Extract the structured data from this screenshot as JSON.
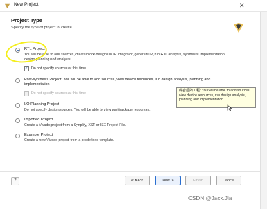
{
  "window": {
    "title": "New Project",
    "close_glyph": "✕"
  },
  "header": {
    "title": "Project Type",
    "subtitle": "Specify the type of project to create."
  },
  "options": [
    {
      "label": "RTL Project",
      "selected": true,
      "description": "You will be able to add sources, create block designs in IP Integrator, generate IP, run RTL analysis, synthesis, implementation, design planning and analysis.",
      "checkbox": {
        "label": "Do not specify sources at this time",
        "checked": true,
        "enabled": true
      }
    },
    {
      "label": "Post-synthesis Project: You will be able to add sources, view device resources, run design analysis, planning and implementation.",
      "selected": false,
      "checkbox": {
        "label": "Do not specify sources at this time",
        "checked": false,
        "enabled": false
      }
    },
    {
      "label": "I/O Planning Project",
      "selected": false,
      "description": "Do not specify design sources. You will be able to view part/package resources."
    },
    {
      "label": "Imported Project",
      "selected": false,
      "description": "Create a Vivado project from a Synplify, XST or ISE Project File."
    },
    {
      "label": "Example Project",
      "selected": false,
      "description": "Create a new Vivado project from a predefined template."
    }
  ],
  "tooltip": {
    "text": "综合后的工程: You will be able to add sources, view device resources, run design analysis, planning and implementation."
  },
  "footer": {
    "back_label": "< Back",
    "next_label": "Next >",
    "finish_label": "Finish",
    "cancel_label": "Cancel"
  },
  "watermark": "CSDN @Jack.Jia",
  "colors": {
    "accent": "#2a6fd0",
    "highlight": "#f4ee1c",
    "tooltip_bg": "#ffffe1"
  },
  "icons": {
    "app": "vivado-icon",
    "logo": "vivado-logo",
    "help": "help-icon"
  }
}
